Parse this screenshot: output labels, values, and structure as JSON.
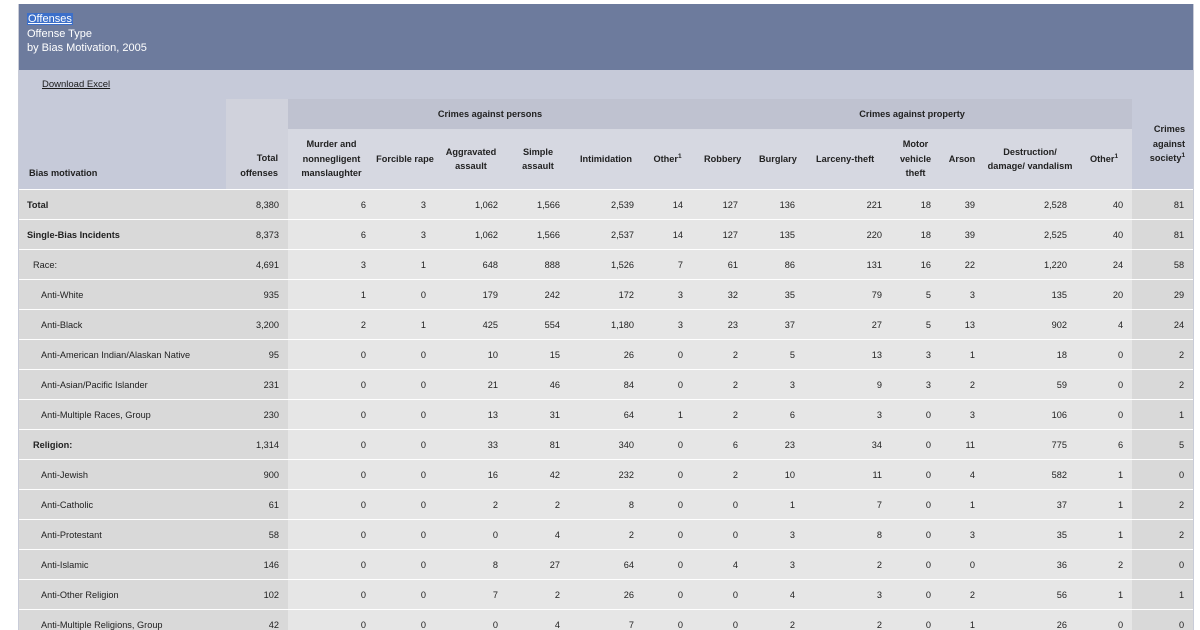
{
  "header": {
    "link": "Offenses",
    "line2": "Offense Type",
    "line3": "by Bias Motivation, 2005"
  },
  "toolbar": {
    "download": "Download Excel"
  },
  "table": {
    "bias_header": "Bias motivation",
    "total_header": "Total offenses",
    "persons_group": "Crimes against persons",
    "property_group": "Crimes against property",
    "society_header": "Crimes against society",
    "footnote_mark": "1",
    "person_cols": [
      "Murder and nonnegligent manslaughter",
      "Forcible rape",
      "Aggravated assault",
      "Simple assault",
      "Intimidation",
      "Other"
    ],
    "property_cols": [
      "Robbery",
      "Burglary",
      "Larceny-theft",
      "Motor vehicle theft",
      "Arson",
      "Destruction/ damage/ vandalism",
      "Other"
    ],
    "rows": [
      {
        "label": "Total",
        "level": 0,
        "bold": true,
        "values": [
          "8,380",
          "6",
          "3",
          "1,062",
          "1,566",
          "2,539",
          "14",
          "127",
          "136",
          "221",
          "18",
          "39",
          "2,528",
          "40",
          "81"
        ]
      },
      {
        "label": "Single-Bias Incidents",
        "level": 0,
        "bold": true,
        "values": [
          "8,373",
          "6",
          "3",
          "1,062",
          "1,566",
          "2,537",
          "14",
          "127",
          "135",
          "220",
          "18",
          "39",
          "2,525",
          "40",
          "81"
        ]
      },
      {
        "label": "Race:",
        "level": 1,
        "bold": false,
        "values": [
          "4,691",
          "3",
          "1",
          "648",
          "888",
          "1,526",
          "7",
          "61",
          "86",
          "131",
          "16",
          "22",
          "1,220",
          "24",
          "58"
        ]
      },
      {
        "label": "Anti-White",
        "level": 2,
        "bold": false,
        "values": [
          "935",
          "1",
          "0",
          "179",
          "242",
          "172",
          "3",
          "32",
          "35",
          "79",
          "5",
          "3",
          "135",
          "20",
          "29"
        ]
      },
      {
        "label": "Anti-Black",
        "level": 2,
        "bold": false,
        "values": [
          "3,200",
          "2",
          "1",
          "425",
          "554",
          "1,180",
          "3",
          "23",
          "37",
          "27",
          "5",
          "13",
          "902",
          "4",
          "24"
        ]
      },
      {
        "label": "Anti-American Indian/Alaskan Native",
        "level": 2,
        "bold": false,
        "values": [
          "95",
          "0",
          "0",
          "10",
          "15",
          "26",
          "0",
          "2",
          "5",
          "13",
          "3",
          "1",
          "18",
          "0",
          "2"
        ]
      },
      {
        "label": "Anti-Asian/Pacific Islander",
        "level": 2,
        "bold": false,
        "values": [
          "231",
          "0",
          "0",
          "21",
          "46",
          "84",
          "0",
          "2",
          "3",
          "9",
          "3",
          "2",
          "59",
          "0",
          "2"
        ]
      },
      {
        "label": "Anti-Multiple Races, Group",
        "level": 2,
        "bold": false,
        "values": [
          "230",
          "0",
          "0",
          "13",
          "31",
          "64",
          "1",
          "2",
          "6",
          "3",
          "0",
          "3",
          "106",
          "0",
          "1"
        ]
      },
      {
        "label": "Religion:",
        "level": 1,
        "bold": true,
        "values": [
          "1,314",
          "0",
          "0",
          "33",
          "81",
          "340",
          "0",
          "6",
          "23",
          "34",
          "0",
          "11",
          "775",
          "6",
          "5"
        ]
      },
      {
        "label": "Anti-Jewish",
        "level": 2,
        "bold": false,
        "values": [
          "900",
          "0",
          "0",
          "16",
          "42",
          "232",
          "0",
          "2",
          "10",
          "11",
          "0",
          "4",
          "582",
          "1",
          "0"
        ]
      },
      {
        "label": "Anti-Catholic",
        "level": 2,
        "bold": false,
        "values": [
          "61",
          "0",
          "0",
          "2",
          "2",
          "8",
          "0",
          "0",
          "1",
          "7",
          "0",
          "1",
          "37",
          "1",
          "2"
        ]
      },
      {
        "label": "Anti-Protestant",
        "level": 2,
        "bold": false,
        "values": [
          "58",
          "0",
          "0",
          "0",
          "4",
          "2",
          "0",
          "0",
          "3",
          "8",
          "0",
          "3",
          "35",
          "1",
          "2"
        ]
      },
      {
        "label": "Anti-Islamic",
        "level": 2,
        "bold": false,
        "values": [
          "146",
          "0",
          "0",
          "8",
          "27",
          "64",
          "0",
          "4",
          "3",
          "2",
          "0",
          "0",
          "36",
          "2",
          "0"
        ]
      },
      {
        "label": "Anti-Other Religion",
        "level": 2,
        "bold": false,
        "values": [
          "102",
          "0",
          "0",
          "7",
          "2",
          "26",
          "0",
          "0",
          "4",
          "3",
          "0",
          "2",
          "56",
          "1",
          "1"
        ]
      },
      {
        "label": "Anti-Multiple Religions, Group",
        "level": 2,
        "bold": false,
        "values": [
          "42",
          "0",
          "0",
          "0",
          "4",
          "7",
          "0",
          "0",
          "2",
          "2",
          "0",
          "1",
          "26",
          "0",
          "0"
        ]
      }
    ]
  },
  "colors": {
    "header_bg": "#6d7b9d",
    "subbar_bg": "#c6cad9",
    "cell_bg": "#e6e6e6",
    "label_bg": "#d9d9d9"
  }
}
